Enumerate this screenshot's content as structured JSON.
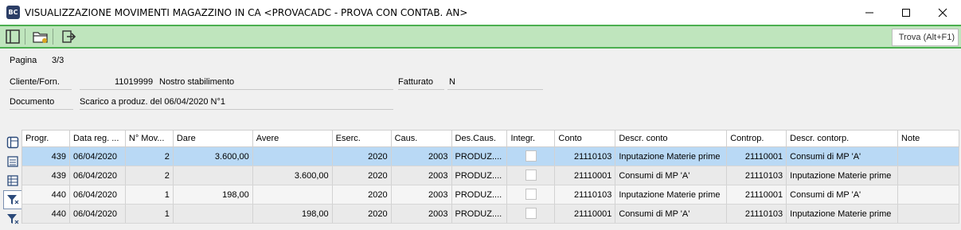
{
  "window": {
    "logo": "BC",
    "title": "VISUALIZZAZIONE MOVIMENTI MAGAZZINO IN CA <PROVACADC - PROVA CON CONTAB. AN>"
  },
  "toolbar": {
    "find_placeholder": "Trova (Alt+F1)",
    "accent": "#4caf50",
    "background": "#bfe5bd"
  },
  "form": {
    "page_label": "Pagina",
    "page_value": "3/3",
    "client_label": "Cliente/Forn.",
    "client_code": "11019999",
    "client_name": "Nostro stabilimento",
    "invoiced_label": "Fatturato",
    "invoiced_value": "N",
    "document_label": "Documento",
    "document_value": "Scarico a produz. del 06/04/2020 N°1"
  },
  "grid": {
    "columns": [
      "Progr.",
      "Data reg. ...",
      "N° Mov...",
      "Dare",
      "Avere",
      "Eserc.",
      "Caus.",
      "Des.Caus.",
      "Integr.",
      "Conto",
      "Descr. conto",
      "Controp.",
      "Descr. contorp.",
      "Note"
    ],
    "rows": [
      {
        "progr": "439",
        "data": "06/04/2020",
        "nmov": "2",
        "dare": "3.600,00",
        "avere": "",
        "eserc": "2020",
        "caus": "2003",
        "descaus": "PRODUZ....",
        "integr": false,
        "conto": "21110103",
        "descconto": "Inputazione Materie prime",
        "controp": "21110001",
        "desccontrop": "Consumi di MP 'A'",
        "note": ""
      },
      {
        "progr": "439",
        "data": "06/04/2020",
        "nmov": "2",
        "dare": "",
        "avere": "3.600,00",
        "eserc": "2020",
        "caus": "2003",
        "descaus": "PRODUZ....",
        "integr": false,
        "conto": "21110001",
        "descconto": "Consumi di MP 'A'",
        "controp": "21110103",
        "desccontrop": "Inputazione Materie prime",
        "note": ""
      },
      {
        "progr": "440",
        "data": "06/04/2020",
        "nmov": "1",
        "dare": "198,00",
        "avere": "",
        "eserc": "2020",
        "caus": "2003",
        "descaus": "PRODUZ....",
        "integr": false,
        "conto": "21110103",
        "descconto": "Inputazione Materie prime",
        "controp": "21110001",
        "desccontrop": "Consumi di MP 'A'",
        "note": ""
      },
      {
        "progr": "440",
        "data": "06/04/2020",
        "nmov": "1",
        "dare": "",
        "avere": "198,00",
        "eserc": "2020",
        "caus": "2003",
        "descaus": "PRODUZ....",
        "integr": false,
        "conto": "21110001",
        "descconto": "Consumi di MP 'A'",
        "controp": "21110103",
        "desccontrop": "Inputazione Materie prime",
        "note": ""
      }
    ],
    "selected_color": "#b9d9f5"
  }
}
